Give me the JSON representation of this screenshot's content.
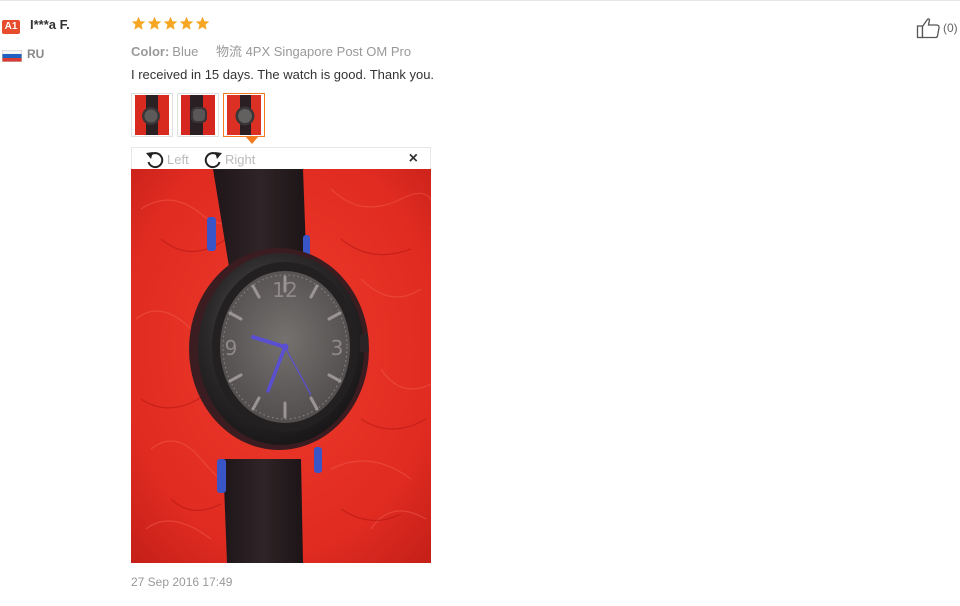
{
  "user": {
    "level_badge": "A1",
    "name": "I***a F.",
    "country": "RU"
  },
  "review": {
    "rating": 5,
    "rating_max": 5,
    "star_color": "#f5a623",
    "attr_label": "Color:",
    "attr_value": "Blue",
    "logistics_label": "物流",
    "logistics_value": "4PX Singapore Post OM Pro",
    "text": "I received in 15 days. The watch is good. Thank you.",
    "date": "27 Sep 2016 17:49",
    "helpful_count": "(0)"
  },
  "viewer": {
    "rotate_left_label": "Left",
    "rotate_right_label": "Right",
    "close_glyph": "×",
    "active_thumbnail": 3,
    "thumbnail_count": 3
  },
  "colors": {
    "accent": "#f47b20",
    "badge": "#e74c2c",
    "cloth_red": "#e02d22",
    "watch_hands": "#5a4fd0"
  },
  "icons": [
    "level-badge",
    "russia-flag-icon",
    "star-icon",
    "rotate-left-icon",
    "rotate-right-icon",
    "close-icon",
    "thumbs-up-icon"
  ]
}
